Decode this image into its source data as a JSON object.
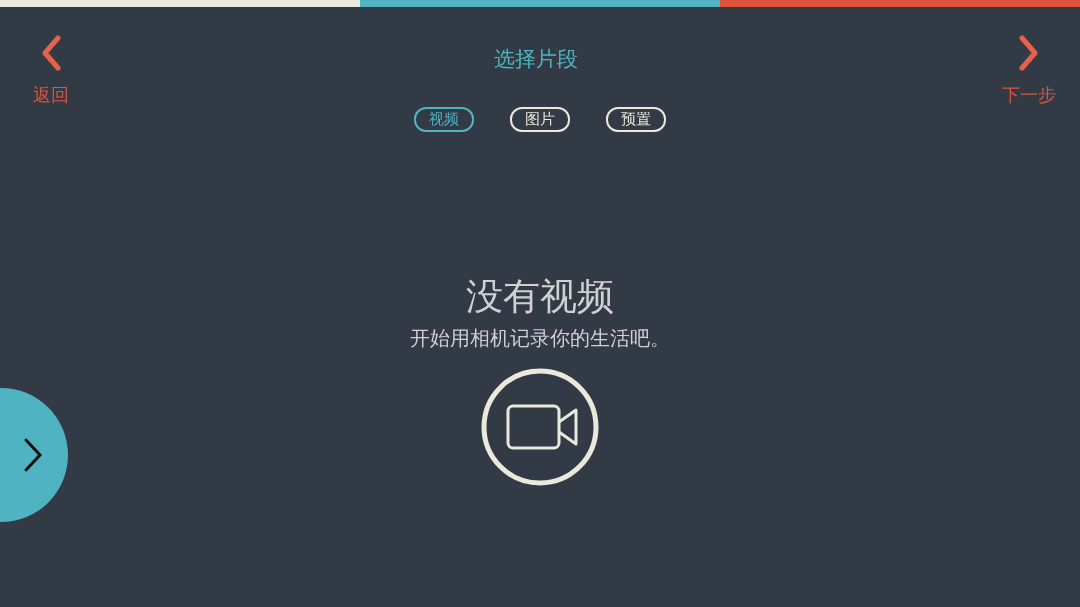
{
  "progress_segments": [
    {
      "color": "#ebe8dc"
    },
    {
      "color": "#4fb3c1"
    },
    {
      "color": "#dd553c"
    }
  ],
  "header": {
    "back_label": "返回",
    "title": "选择片段",
    "next_label": "下一步"
  },
  "tabs": [
    {
      "label": "视频",
      "selected": true
    },
    {
      "label": "图片",
      "selected": false
    },
    {
      "label": "预置",
      "selected": false
    }
  ],
  "empty_state": {
    "title": "没有视频",
    "message": "开始用相机记录你的生活吧。"
  }
}
